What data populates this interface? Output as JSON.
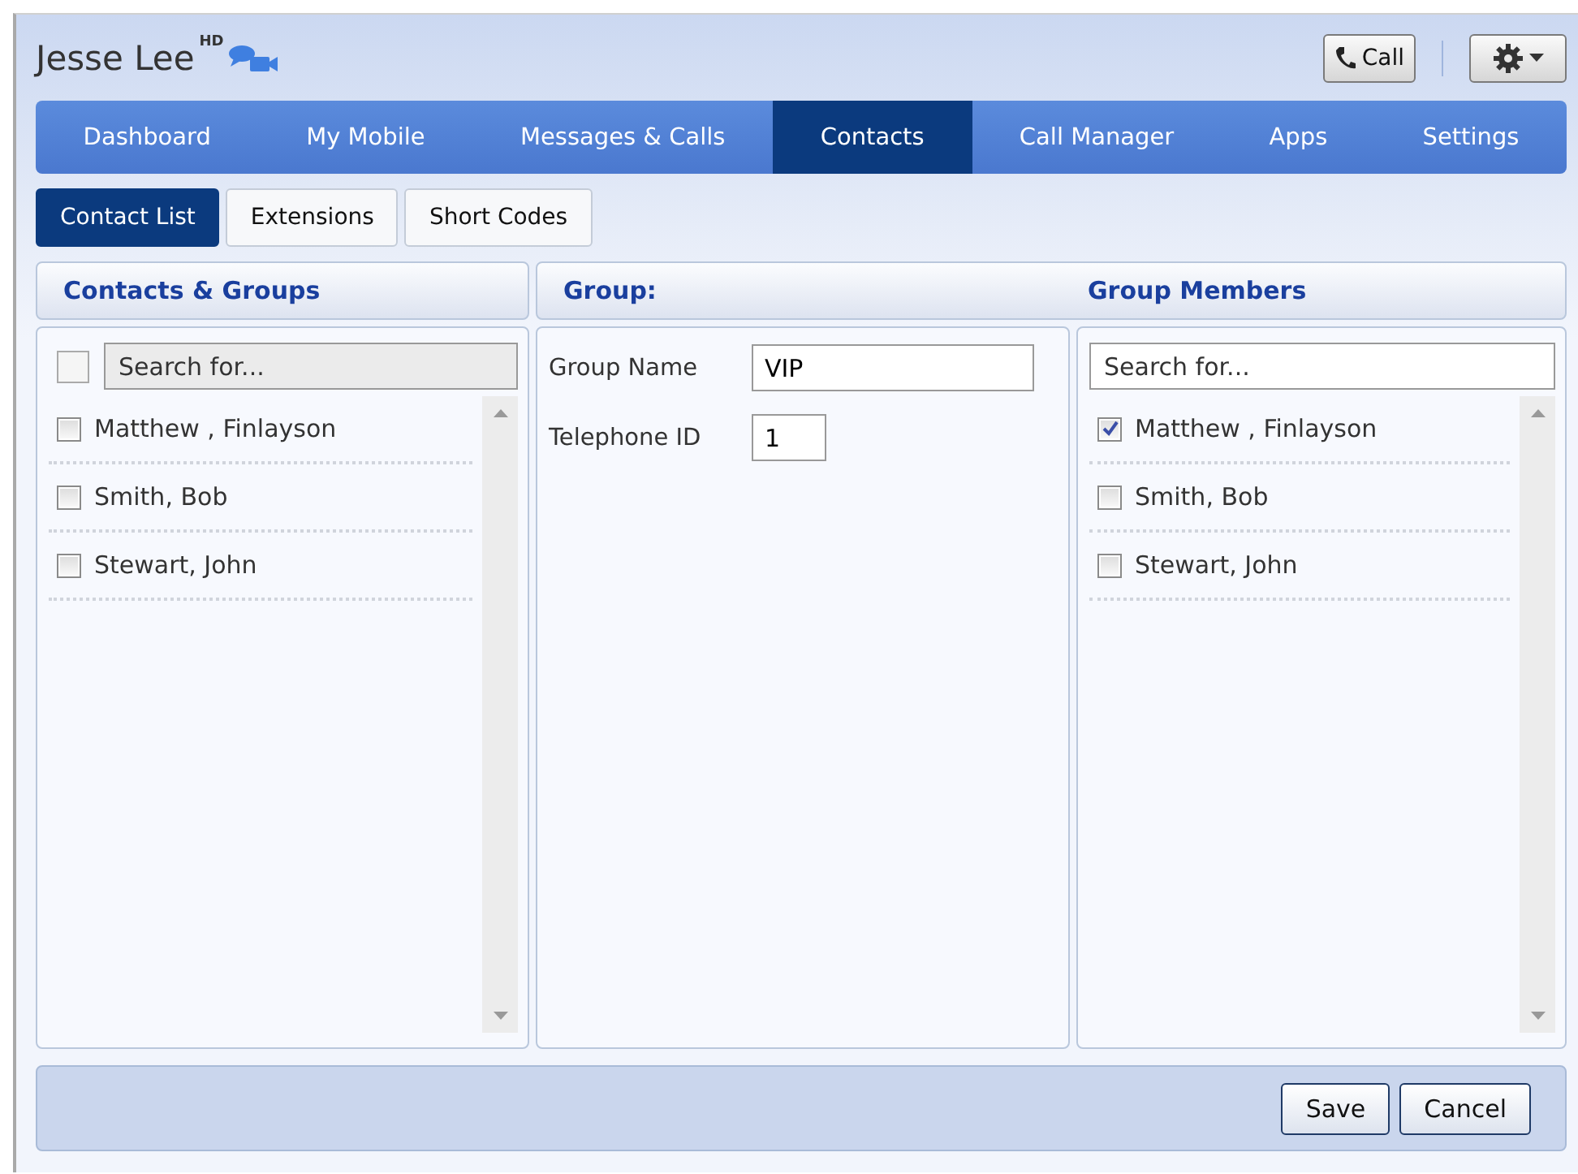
{
  "header": {
    "title": "Jesse Lee",
    "badge": "HD",
    "call_button": "Call"
  },
  "nav_tabs": [
    {
      "label": "Dashboard",
      "selected": false
    },
    {
      "label": "My Mobile",
      "selected": false
    },
    {
      "label": "Messages & Calls",
      "selected": false
    },
    {
      "label": "Contacts",
      "selected": true
    },
    {
      "label": "Call Manager",
      "selected": false
    },
    {
      "label": "Apps",
      "selected": false
    },
    {
      "label": "Settings",
      "selected": false
    }
  ],
  "sub_tabs": [
    {
      "label": "Contact List",
      "selected": true
    },
    {
      "label": "Extensions",
      "selected": false
    },
    {
      "label": "Short Codes",
      "selected": false
    }
  ],
  "contacts_panel": {
    "heading": "Contacts & Groups",
    "select_all_checked": false,
    "search_placeholder": "Search for...",
    "contacts": [
      {
        "name": "Matthew , Finlayson",
        "checked": false
      },
      {
        "name": "Smith, Bob",
        "checked": false
      },
      {
        "name": "Stewart, John",
        "checked": false
      }
    ]
  },
  "group_panel": {
    "heading": "Group:",
    "fields": [
      {
        "label": "Group Name",
        "value": "VIP"
      },
      {
        "label": "Telephone ID",
        "value": "1"
      }
    ]
  },
  "members_panel": {
    "heading": "Group Members",
    "search_placeholder": "Search for...",
    "members": [
      {
        "name": "Matthew , Finlayson",
        "checked": true
      },
      {
        "name": "Smith, Bob",
        "checked": false
      },
      {
        "name": "Stewart, John",
        "checked": false
      }
    ]
  },
  "buttons": [
    "Save",
    "Cancel"
  ]
}
